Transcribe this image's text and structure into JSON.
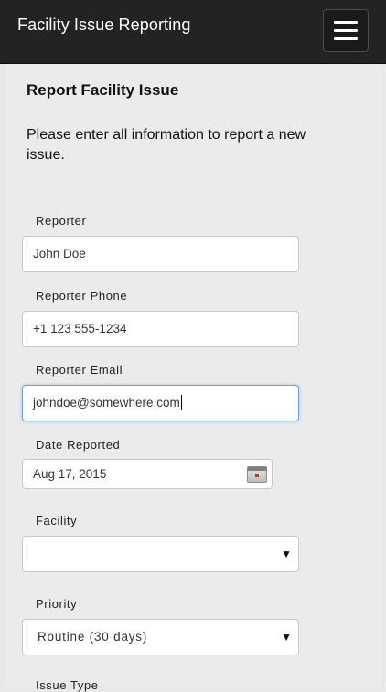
{
  "navbar": {
    "title": "Facility Issue Reporting",
    "menu_icon": "hamburger-menu-icon"
  },
  "form": {
    "heading": "Report Facility Issue",
    "intro": "Please enter all information to report a new issue.",
    "reporter": {
      "label": "Reporter",
      "value": "John Doe"
    },
    "reporter_phone": {
      "label": "Reporter Phone",
      "value": "+1 123 555-1234"
    },
    "reporter_email": {
      "label": "Reporter Email",
      "value": "johndoe@somewhere.com"
    },
    "date_reported": {
      "label": "Date Reported",
      "value": "Aug 17, 2015",
      "icon": "calendar-icon"
    },
    "facility": {
      "label": "Facility",
      "value": ""
    },
    "priority": {
      "label": "Priority",
      "value": "Routine (30 days)"
    },
    "issue_type": {
      "label": "Issue Type"
    }
  },
  "colors": {
    "navbar_bg": "#232323",
    "page_bg": "#ebebeb",
    "focus_border": "#6fa6d8"
  }
}
